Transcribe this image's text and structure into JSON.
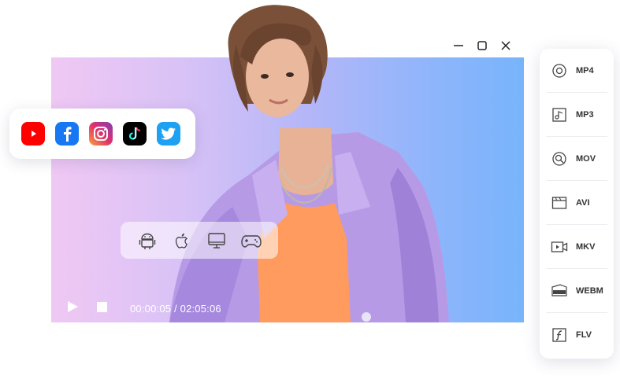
{
  "window": {
    "controls": [
      {
        "name": "minimize",
        "icon": "minimize-icon"
      },
      {
        "name": "maximize",
        "icon": "maximize-icon"
      },
      {
        "name": "close",
        "icon": "close-icon"
      }
    ]
  },
  "social": {
    "items": [
      {
        "name": "youtube",
        "icon": "youtube-icon",
        "color": "#ff0000"
      },
      {
        "name": "facebook",
        "icon": "facebook-icon",
        "color": "#1877f2"
      },
      {
        "name": "instagram",
        "icon": "instagram-icon",
        "color": "#e1306c"
      },
      {
        "name": "tiktok",
        "icon": "tiktok-icon",
        "color": "#000000"
      },
      {
        "name": "twitter",
        "icon": "twitter-icon",
        "color": "#1da1f2"
      }
    ]
  },
  "devices": {
    "items": [
      {
        "name": "android",
        "icon": "android-icon"
      },
      {
        "name": "apple",
        "icon": "apple-icon"
      },
      {
        "name": "tv",
        "icon": "tv-icon"
      },
      {
        "name": "gamepad",
        "icon": "gamepad-icon"
      }
    ]
  },
  "player": {
    "time": "00:00:05 / 02:05:06"
  },
  "formats": {
    "items": [
      {
        "label": "MP4",
        "icon": "mp4-icon"
      },
      {
        "label": "MP3",
        "icon": "mp3-icon"
      },
      {
        "label": "MOV",
        "icon": "mov-icon"
      },
      {
        "label": "AVI",
        "icon": "avi-icon"
      },
      {
        "label": "MKV",
        "icon": "mkv-icon"
      },
      {
        "label": "WEBM",
        "icon": "webm-icon"
      },
      {
        "label": "FLV",
        "icon": "flv-icon"
      }
    ]
  },
  "colors": {
    "gradient_start": "#f0c8f4",
    "gradient_end": "#78b4fb",
    "jacket": "#b89be8",
    "shirt": "#ff9a5c"
  }
}
